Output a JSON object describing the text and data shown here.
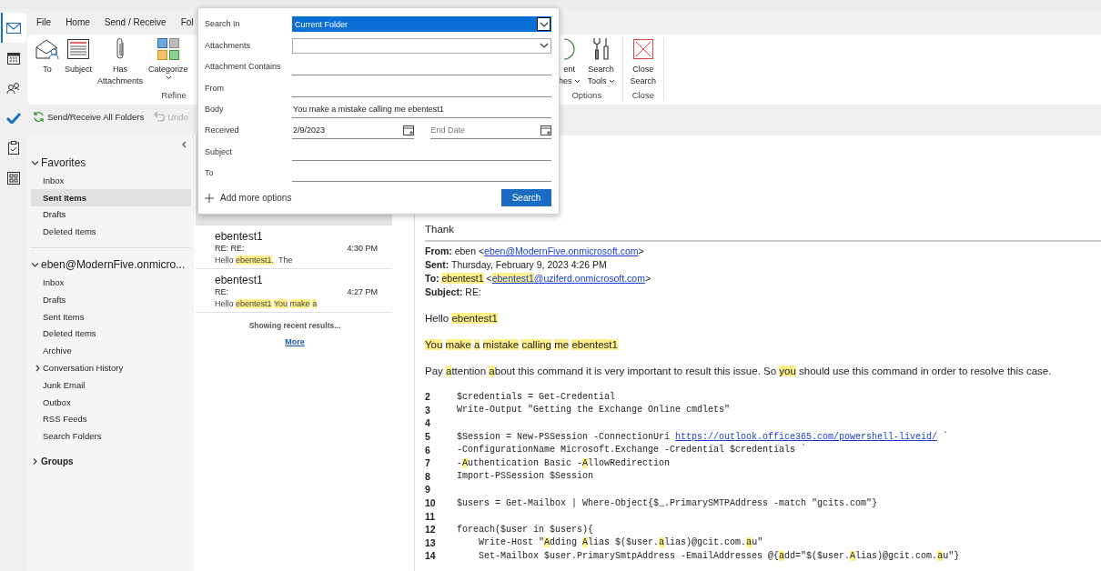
{
  "nav_rail": [
    {
      "kind": "mail",
      "selected": true
    },
    {
      "kind": "calendar",
      "selected": false
    },
    {
      "kind": "people",
      "selected": false
    },
    {
      "kind": "todo",
      "selected": false
    },
    {
      "kind": "tasks",
      "selected": false
    },
    {
      "kind": "apps",
      "selected": false
    }
  ],
  "menu_tabs": [
    "File",
    "Home",
    "Send / Receive",
    "Fol"
  ],
  "ribbon": {
    "groups": [
      {
        "label": "Refine",
        "buttons": [
          {
            "kind": "to",
            "lines": [
              "To"
            ],
            "caret": false
          },
          {
            "kind": "subject",
            "lines": [
              "Subject"
            ],
            "caret": false
          },
          {
            "kind": "attachments",
            "lines": [
              "Has",
              "Attachments"
            ],
            "caret": false
          },
          {
            "kind": "categorize",
            "lines": [
              "Categorize"
            ],
            "caret": true
          }
        ]
      },
      {
        "label": "Options",
        "buttons": [
          {
            "kind": "recent",
            "lines": [
              "ent",
              "hes"
            ],
            "caret": true
          },
          {
            "kind": "tools",
            "lines": [
              "Search",
              "Tools"
            ],
            "caret": true
          }
        ]
      },
      {
        "label": "Close",
        "buttons": [
          {
            "kind": "close",
            "lines": [
              "Close",
              "Search"
            ],
            "caret": false
          }
        ]
      }
    ]
  },
  "quick_access": [
    {
      "kind": "sync",
      "label": "Send/Receive All Folders",
      "disabled": false
    },
    {
      "kind": "undo",
      "label": "Undo",
      "disabled": true
    }
  ],
  "folders": [
    {
      "label": "Favorites",
      "expanded": true,
      "children": [
        {
          "label": "Inbox",
          "selected": false
        },
        {
          "label": "Sent Items",
          "selected": true
        },
        {
          "label": "Drafts",
          "selected": false
        },
        {
          "label": "Deleted Items",
          "selected": false
        }
      ]
    },
    {
      "label": "eben@ModernFive.onmicro...",
      "expanded": true,
      "children": [
        {
          "label": "Inbox",
          "selected": false
        },
        {
          "label": "Drafts",
          "selected": false
        },
        {
          "label": "Sent Items",
          "selected": false
        },
        {
          "label": "Deleted Items",
          "selected": false
        },
        {
          "label": "Archive",
          "selected": false
        },
        {
          "label": "Conversation History",
          "selected": false,
          "expanded": false
        },
        {
          "label": "Junk Email",
          "selected": false
        },
        {
          "label": "Outbox",
          "selected": false
        },
        {
          "label": "RSS Feeds",
          "selected": false
        },
        {
          "label": "Search Folders",
          "selected": false
        }
      ]
    },
    {
      "label": "Groups",
      "expanded": false
    }
  ],
  "messages": [
    {
      "sender": "ebentest1",
      "subject": "RE: RE:",
      "time": "4:30 PM",
      "preview": [
        {
          "text": "Hello ",
          "highlighted": false
        },
        {
          "text": "ebentest1",
          "highlighted": true
        },
        {
          "text": ",  The",
          "highlighted": false
        }
      ]
    },
    {
      "sender": "ebentest1",
      "subject": "RE:",
      "time": "4:27 PM",
      "preview": [
        {
          "text": "Hello ",
          "highlighted": false
        },
        {
          "text": "ebentest1",
          "highlighted": true
        },
        {
          "text": "You",
          "highlighted": true,
          "space_before": true
        },
        {
          "text": "make",
          "highlighted": true,
          "space_before": true
        },
        {
          "text": "a",
          "highlighted": true,
          "space_before": true
        }
      ]
    }
  ],
  "list_status": "Showing recent results...",
  "list_more": "More",
  "search_popup": {
    "fields": [
      {
        "kind": "dropdown",
        "label": "Search In",
        "value": "Current Folder",
        "focused": true
      },
      {
        "kind": "dropdown",
        "label": "Attachments",
        "focused": false
      },
      {
        "kind": "text",
        "label": "Attachment Contains"
      },
      {
        "kind": "text",
        "label": "From"
      },
      {
        "kind": "text",
        "label": "Body",
        "value": "You make a mistake calling me ebentest1"
      },
      {
        "kind": "dates",
        "label": "Received",
        "value": "2/9/2023",
        "placeholder": "End Date"
      },
      {
        "kind": "text",
        "label": "Subject"
      },
      {
        "kind": "text",
        "label": "To"
      }
    ],
    "add_more": "Add more options",
    "search_button": "Search"
  },
  "reading": {
    "title": "Thank",
    "header": [
      {
        "label": "From:",
        "segments": [
          {
            "text": " eben <",
            "highlighted": false,
            "link": false
          },
          {
            "text": "eben@ModernFive.onmicrosoft.com",
            "highlighted": false,
            "link": true
          },
          {
            "text": ">",
            "highlighted": false,
            "link": false
          }
        ]
      },
      {
        "label": "Sent:",
        "segments": [
          {
            "text": " Thursday, February 9, 2023 4:26 PM",
            "highlighted": false,
            "link": false
          }
        ]
      },
      {
        "label": "To:",
        "segments": [
          {
            "text": "ebentest1",
            "highlighted": true,
            "link": false,
            "space_before": true
          },
          {
            "text": " <",
            "highlighted": false,
            "link": false
          },
          {
            "text": "ebentest1",
            "highlighted": true,
            "link": true
          },
          {
            "text": "@uziferd.onmicrosoft.com",
            "highlighted": false,
            "link": true
          },
          {
            "text": ">",
            "highlighted": false,
            "link": false
          }
        ]
      },
      {
        "label": "Subject:",
        "segments": [
          {
            "text": " RE:",
            "highlighted": false,
            "link": false
          }
        ]
      }
    ],
    "paragraphs": [
      {
        "segments": [
          {
            "text": "Hello ",
            "highlighted": false
          },
          {
            "text": "ebentest1",
            "highlighted": true
          }
        ]
      },
      {
        "segments": [
          {
            "text": "You",
            "highlighted": true
          },
          {
            "text": "make",
            "highlighted": true,
            "space_before": true
          },
          {
            "text": "a",
            "highlighted": true,
            "space_before": true
          },
          {
            "text": "mistake",
            "highlighted": true,
            "space_before": true
          },
          {
            "text": "calling",
            "highlighted": true,
            "space_before": true
          },
          {
            "text": "me",
            "highlighted": true,
            "space_before": true
          },
          {
            "text": "ebentest1",
            "highlighted": true,
            "space_before": true
          }
        ]
      },
      {
        "segments": [
          {
            "text": "Pay ",
            "highlighted": false
          },
          {
            "text": "a",
            "highlighted": true
          },
          {
            "text": "ttention ",
            "highlighted": false
          },
          {
            "text": "a",
            "highlighted": true
          },
          {
            "text": "bout this command it is very important to result this issue. So ",
            "highlighted": false
          },
          {
            "text": "you",
            "highlighted": true
          },
          {
            "text": " should use this command in order to resolve this case.",
            "highlighted": false
          }
        ]
      }
    ],
    "code": [
      {
        "number": "2",
        "segments": [
          {
            "text": "$credentials = Get-Credential",
            "highlighted": false,
            "link": false
          }
        ]
      },
      {
        "number": "3",
        "segments": [
          {
            "text": "Write-Output \"Getting the Exchange Online cmdlets\"",
            "highlighted": false,
            "link": false
          }
        ]
      },
      {
        "number": "4"
      },
      {
        "number": "5",
        "segments": [
          {
            "text": "$Session = New-PSSession -ConnectionUri ",
            "highlighted": false,
            "link": false
          },
          {
            "text": "https://outlook.office365.com/powershell-liveid/",
            "highlighted": false,
            "link": true
          },
          {
            "text": " `",
            "highlighted": false,
            "link": false
          }
        ]
      },
      {
        "number": "6",
        "segments": [
          {
            "text": "-ConfigurationName Microsoft.Exchange -Credential $credentials `",
            "highlighted": false,
            "link": false
          }
        ]
      },
      {
        "number": "7",
        "segments": [
          {
            "text": "-",
            "highlighted": false,
            "link": false
          },
          {
            "text": "A",
            "highlighted": true,
            "link": false
          },
          {
            "text": "uthentication Basic -",
            "highlighted": false,
            "link": false
          },
          {
            "text": "A",
            "highlighted": true,
            "link": false
          },
          {
            "text": "llowRedirection",
            "highlighted": false,
            "link": false
          }
        ]
      },
      {
        "number": "8",
        "segments": [
          {
            "text": "Import-PSSession $Session",
            "highlighted": false,
            "link": false
          }
        ]
      },
      {
        "number": "9"
      },
      {
        "number": "10",
        "segments": [
          {
            "text": "$users = Get-Mailbox | Where-Object{$_.PrimarySMTPAddress -match \"gcits.com\"}",
            "highlighted": false,
            "link": false
          }
        ]
      },
      {
        "number": "11"
      },
      {
        "number": "12",
        "segments": [
          {
            "text": "foreach($user in $users){",
            "highlighted": false,
            "link": false
          }
        ]
      },
      {
        "number": "13",
        "segments": [
          {
            "text": "    Write-Host \"",
            "highlighted": false,
            "link": false
          },
          {
            "text": "A",
            "highlighted": true,
            "link": false
          },
          {
            "text": "dding ",
            "highlighted": false,
            "link": false
          },
          {
            "text": "A",
            "highlighted": true,
            "link": false
          },
          {
            "text": "lias $($user.",
            "highlighted": false,
            "link": false
          },
          {
            "text": "a",
            "highlighted": true,
            "link": false
          },
          {
            "text": "lias)@gcit.com.",
            "highlighted": false,
            "link": false
          },
          {
            "text": "a",
            "highlighted": true,
            "link": false
          },
          {
            "text": "u\"",
            "highlighted": false,
            "link": false
          }
        ]
      },
      {
        "number": "14",
        "segments": [
          {
            "text": "    Set-Mailbox $user.PrimarySmtpAddress -EmailAddresses @{",
            "highlighted": false,
            "link": false
          },
          {
            "text": "a",
            "highlighted": true,
            "link": false
          },
          {
            "text": "dd=\"$($user.",
            "highlighted": false,
            "link": false
          },
          {
            "text": "A",
            "highlighted": true,
            "link": false
          },
          {
            "text": "lias)@gcit.com.",
            "highlighted": false,
            "link": false
          },
          {
            "text": "a",
            "highlighted": true,
            "link": false
          },
          {
            "text": "u\"}",
            "highlighted": false,
            "link": false
          }
        ]
      }
    ]
  }
}
